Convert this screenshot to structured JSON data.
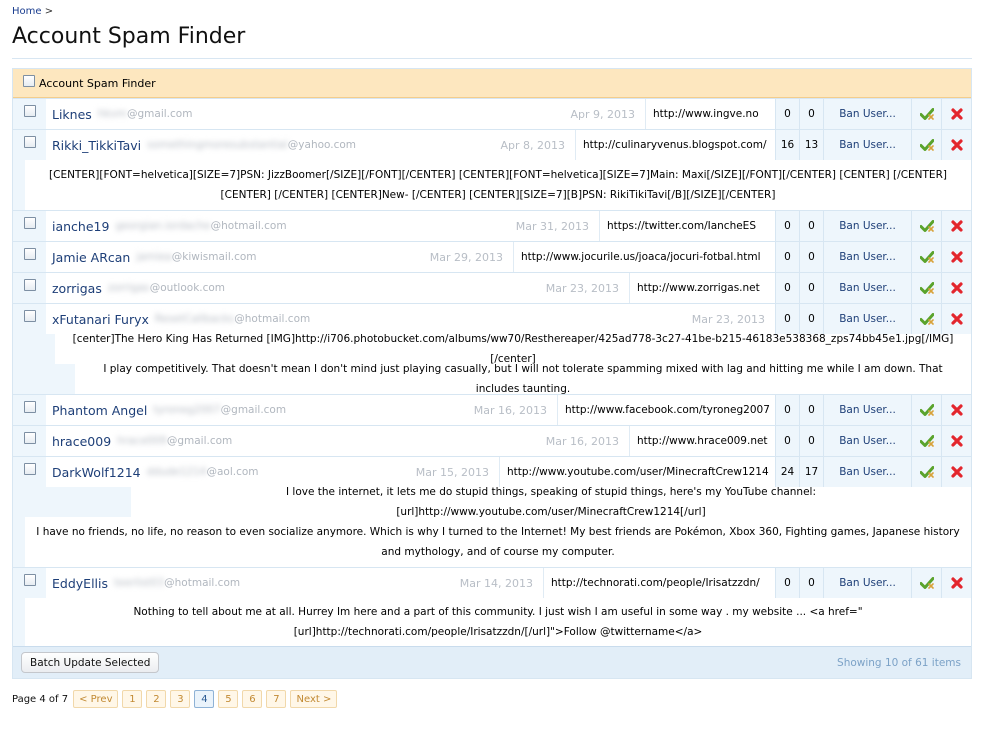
{
  "breadcrumb": {
    "home": "Home",
    "sep": ">"
  },
  "page": {
    "title": "Account Spam Finder"
  },
  "header": {
    "label": "Account Spam Finder"
  },
  "users": [
    {
      "name": "Liknes",
      "email_hidden": "hkvm",
      "email_domain": "@gmail.com",
      "date": "Apr 9, 2013",
      "url": "http://www.ingve.no",
      "n1": "0",
      "n2": "0",
      "ban": "Ban User...",
      "url_w": 130,
      "notes": []
    },
    {
      "name": "Rikki_TikkiTavi",
      "email_hidden": "somethingmoresubstantial",
      "email_domain": "@yahoo.com",
      "date": "Apr 8, 2013",
      "url": "http://culinaryvenus.blogspot.com/",
      "n1": "16",
      "n2": "13",
      "ban": "Ban User...",
      "url_w": 200,
      "notes": [
        {
          "text": "[CENTER][FONT=helvetica][SIZE=7]PSN: JizzBoomer[/SIZE][/FONT][/CENTER] [CENTER][FONT=helvetica][SIZE=7]Main: Maxi[/SIZE][/FONT][/CENTER] [CENTER] [/CENTER] [CENTER] [/CENTER] [CENTER]New- [/CENTER] [CENTER][SIZE=7][B]PSN: RikiTikiTavi[/B][/SIZE][/CENTER]",
          "h": 50,
          "indent": 12
        }
      ]
    },
    {
      "name": "ianche19",
      "email_hidden": "georgian.iordache",
      "email_domain": "@hotmail.com",
      "date": "Mar 31, 2013",
      "url": "https://twitter.com/IancheES",
      "n1": "0",
      "n2": "0",
      "ban": "Ban User...",
      "url_w": 176,
      "notes": []
    },
    {
      "name": "Jamie ARcan",
      "email_hidden": "jamiea",
      "email_domain": "@kiwismail.com",
      "date": "Mar 29, 2013",
      "url": "http://www.jocurile.us/joaca/jocuri-fotbal.html",
      "n1": "0",
      "n2": "0",
      "ban": "Ban User...",
      "url_w": 262,
      "notes": []
    },
    {
      "name": "zorrigas",
      "email_hidden": "zorrigas",
      "email_domain": "@outlook.com",
      "date": "Mar 23, 2013",
      "url": "http://www.zorrigas.net",
      "n1": "0",
      "n2": "0",
      "ban": "Ban User...",
      "url_w": 146,
      "notes": []
    },
    {
      "name": "xFutanari Furyx",
      "email_hidden": "ResetCallbacks",
      "email_domain": "@hotmail.com",
      "date": "Mar 23, 2013",
      "url": "",
      "n1": "0",
      "n2": "0",
      "ban": "Ban User...",
      "url_w": 0,
      "notes": [
        {
          "text": "[center]The Hero King Has Returned [IMG]http://i706.photobucket.com/albums/ww70/Resthereaper/425ad778-3c27-41be-b215-46183e538368_zps74bb45e1.jpg[/IMG] [/center]",
          "h": 30,
          "indent": 42
        },
        {
          "text": "I play competitively. That doesn't mean I don't mind just playing casually, but I will not tolerate spamming mixed with lag and hitting me while I am down. That includes taunting.",
          "h": 30,
          "indent": 62
        }
      ]
    },
    {
      "name": "Phantom Angel",
      "email_hidden": "tyroneg2007",
      "email_domain": "@gmail.com",
      "date": "Mar 16, 2013",
      "url": "http://www.facebook.com/tyroneg2007",
      "n1": "0",
      "n2": "0",
      "ban": "Ban User...",
      "url_w": 218,
      "notes": []
    },
    {
      "name": "hrace009",
      "email_hidden": "hrace009",
      "email_domain": "@gmail.com",
      "date": "Mar 16, 2013",
      "url": "http://www.hrace009.net",
      "n1": "0",
      "n2": "0",
      "ban": "Ban User...",
      "url_w": 146,
      "notes": []
    },
    {
      "name": "DarkWolf1214",
      "email_hidden": "ddude1214",
      "email_domain": "@aol.com",
      "date": "Mar 15, 2013",
      "url": "http://www.youtube.com/user/MinecraftCrew1214",
      "n1": "24",
      "n2": "17",
      "ban": "Ban User...",
      "url_w": 276,
      "notes": [
        {
          "text": "I love the internet, it lets me do stupid things, speaking of stupid things, here's my YouTube channel: [url]http://www.youtube.com/user/MinecraftCrew1214[/url]",
          "h": 30,
          "indent": 118
        },
        {
          "text": "I have no friends, no life, no reason to even socialize anymore. Which is why I turned to the Internet! My best friends are Pokémon, Xbox 360, Fighting games, Japanese history and mythology, and of course my computer.",
          "h": 50,
          "indent": 12
        }
      ]
    },
    {
      "name": "EddyEllis",
      "email_hidden": "teerlist03",
      "email_domain": "@hotmail.com",
      "date": "Mar 14, 2013",
      "url": "http://technorati.com/people/Irisatzzdn/",
      "n1": "0",
      "n2": "0",
      "ban": "Ban User...",
      "url_w": 232,
      "notes": [
        {
          "text": "Nothing to tell about me at all. Hurrey Im here and a part of this community. I just wish I am useful in some way . my website ... <a href=\"[url]http://technorati.com/people/Irisatzzdn/[/url]\">Follow @twittername</a>",
          "h": 48,
          "indent": 12
        }
      ]
    }
  ],
  "footer": {
    "batch_button": "Batch Update Selected",
    "showing": "Showing 10 of 61 items"
  },
  "pager": {
    "label": "Page 4 of 7",
    "prev": "< Prev",
    "next": "Next >",
    "pages": [
      "1",
      "2",
      "3",
      "4",
      "5",
      "6",
      "7"
    ],
    "current": "4"
  },
  "icons": {
    "approve": "green-check-icon",
    "delete": "red-x-icon"
  },
  "colors": {
    "header_bg": "#fde7bf",
    "link": "#1e3f78",
    "row_bg": "#eef6fc"
  }
}
